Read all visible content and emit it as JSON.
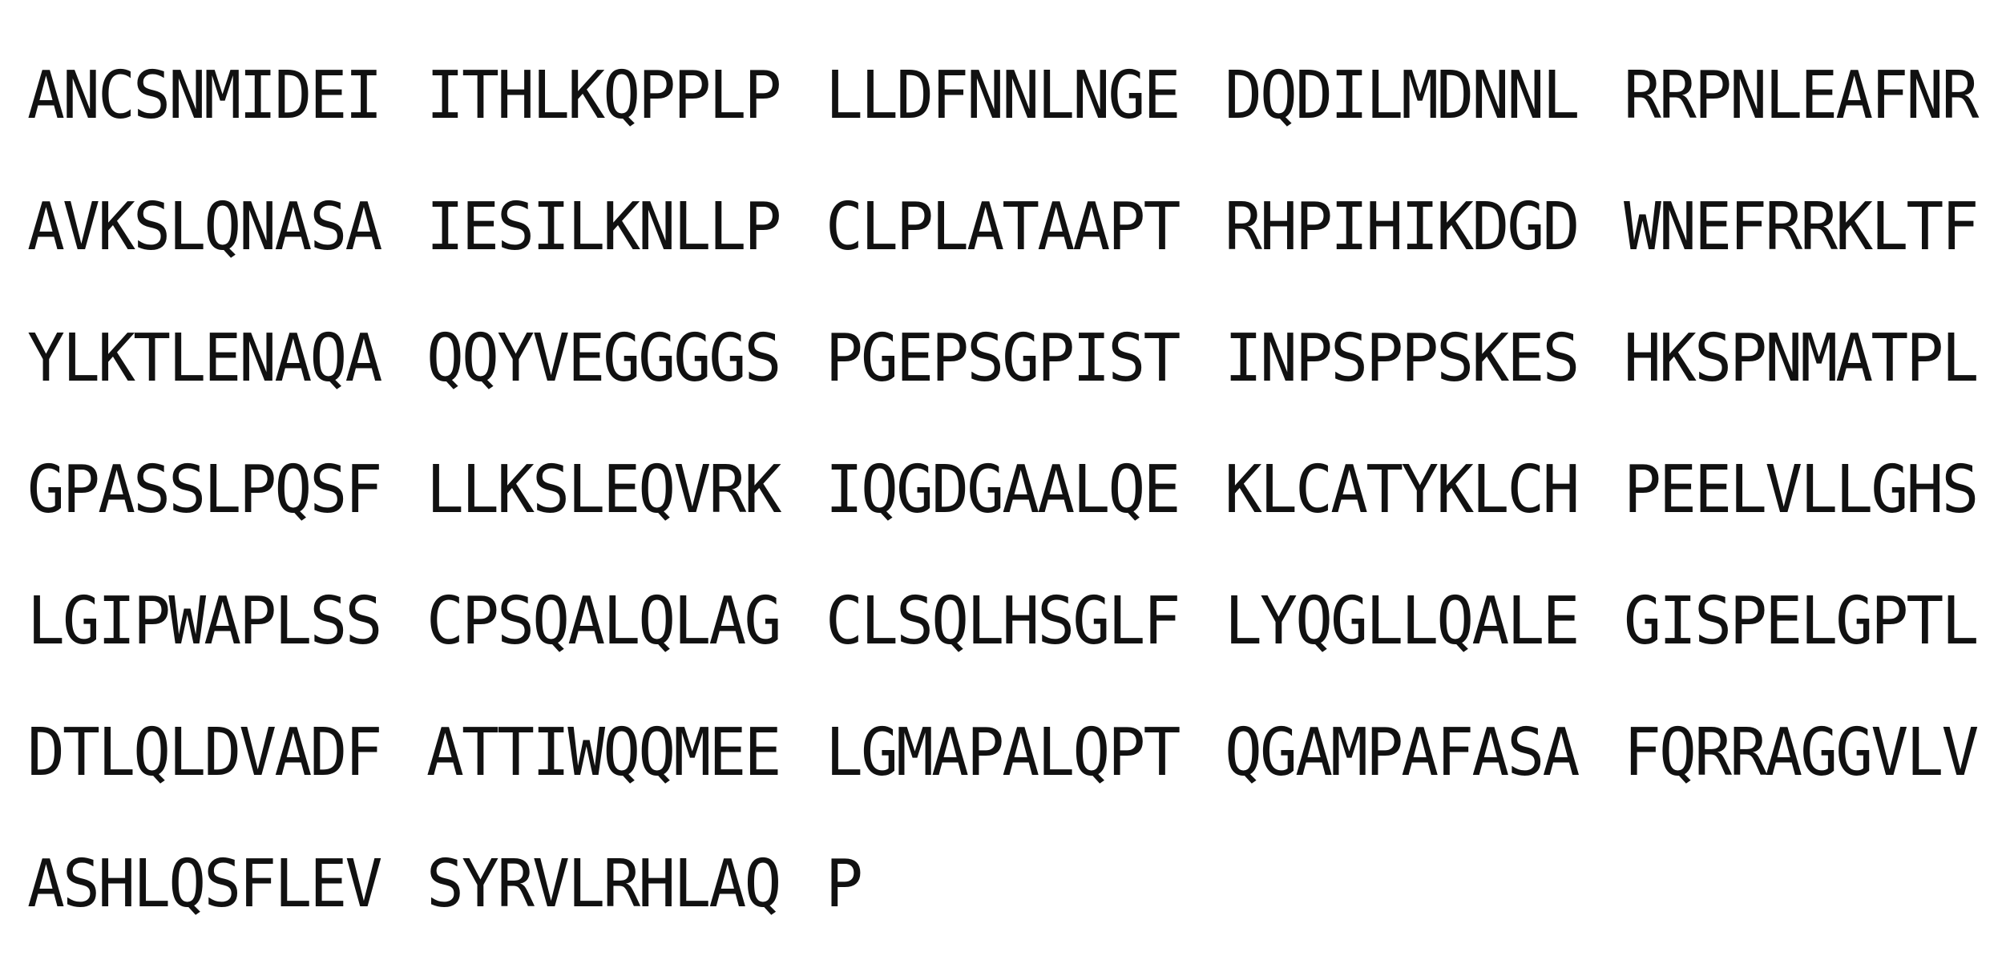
{
  "sequence": {
    "lines": [
      [
        "ANCSNMIDEI",
        "ITHLKQPPLP",
        "LLDFNNLNGE",
        "DQDILMDNNL",
        "RRPNLEAFNR"
      ],
      [
        "AVKSLQNASA",
        "IESILKNLLP",
        "CLPLATAAPT",
        "RHPIHIKDGD",
        "WNEFRRKLTF"
      ],
      [
        "YLKTLENAQA",
        "QQYVEGGGGS",
        "PGEPSGPIST",
        "INPSPPSKES",
        "HKSPNMATPL"
      ],
      [
        "GPASSLPQSF",
        "LLKSLEQVRK",
        "IQGDGAALQE",
        "KLCATYKLCH",
        "PEELVLLGHS"
      ],
      [
        "LGIPWAPLSS",
        "CPSQALQLAG",
        "CLSQLHSGLF",
        "LYQGLLQALE",
        "GISPELGPTL"
      ],
      [
        "DTLQLDVADF",
        "ATTIWQQMEE",
        "LGMAPALQPT",
        "QGAMPAFASA",
        "FQRRAGGVLV"
      ],
      [
        "ASHLQSFLEV",
        "SYRVLRHLAQ",
        "P"
      ]
    ]
  }
}
